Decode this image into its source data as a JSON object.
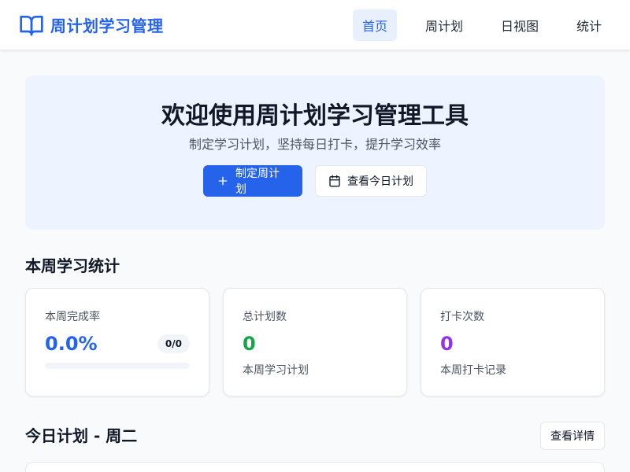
{
  "app": {
    "title": "周计划学习管理",
    "brand_icon": "book-open-icon",
    "brand_color": "#2563eb"
  },
  "nav": {
    "items": [
      {
        "label": "首页",
        "active": true
      },
      {
        "label": "周计划",
        "active": false
      },
      {
        "label": "日视图",
        "active": false
      },
      {
        "label": "统计",
        "active": false
      }
    ]
  },
  "hero": {
    "title": "欢迎使用周计划学习管理工具",
    "subtitle": "制定学习计划，坚持每日打卡，提升学习效率",
    "primary_button": {
      "label": "制定周计划",
      "icon": "plus-icon"
    },
    "secondary_button": {
      "label": "查看今日计划",
      "icon": "calendar-icon"
    }
  },
  "stats": {
    "section_title": "本周学习统计",
    "completion": {
      "label": "本周完成率",
      "value": "0.0%",
      "badge": "0/0",
      "progress": 0.0,
      "color": "#2563eb"
    },
    "plans": {
      "label": "总计划数",
      "value": "0",
      "desc": "本周学习计划",
      "color": "#16a34a"
    },
    "checkins": {
      "label": "打卡次数",
      "value": "0",
      "desc": "本周打卡记录",
      "color": "#9333ea"
    }
  },
  "today": {
    "title": "今日计划 - 周二",
    "detail_button": "查看详情"
  }
}
